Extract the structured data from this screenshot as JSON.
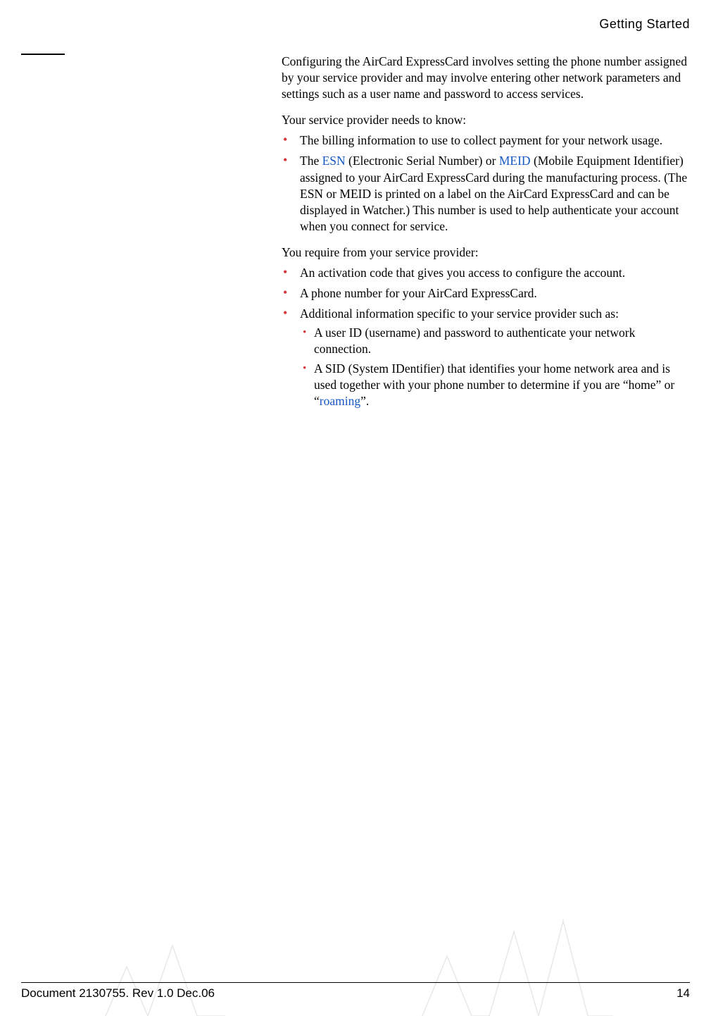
{
  "header": {
    "section_title": "Getting Started"
  },
  "body": {
    "intro": "Configuring the AirCard ExpressCard involves setting the phone number assigned by your service provider and may involve entering other network parameters and settings such as a user name and password to access services.",
    "provider_needs_label": "Your service provider needs to know:",
    "provider_needs": {
      "item1": "The billing information to use to collect payment for your network usage.",
      "item2_pre": "The ",
      "item2_link1": "ESN",
      "item2_mid1": " (Electronic Serial Number) or ",
      "item2_link2": "MEID",
      "item2_post": " (Mobile Equipment Identifier) assigned to your AirCard ExpressCard during the manufacturing process. (The ESN or MEID is printed on a label on the AirCard ExpressCard and can be displayed in Watcher.) This number is used to help authenticate your account when you connect for service."
    },
    "you_require_label": "You require from your service provider:",
    "you_require": {
      "item1": "An activation code that gives you access to configure the account.",
      "item2": "A phone number for your AirCard ExpressCard.",
      "item3_intro": "Additional information specific to your service provider such as:",
      "item3_sub1": "A user ID (username) and password to authenticate your network connection.",
      "item3_sub2_pre": "A SID (System IDentifier) that identifies your home network area and is used together with your phone number to determine if you are “home” or “",
      "item3_sub2_link": "roaming",
      "item3_sub2_post": "”."
    }
  },
  "footer": {
    "doc_info": "Document 2130755. Rev 1.0  Dec.06",
    "page": "14"
  }
}
